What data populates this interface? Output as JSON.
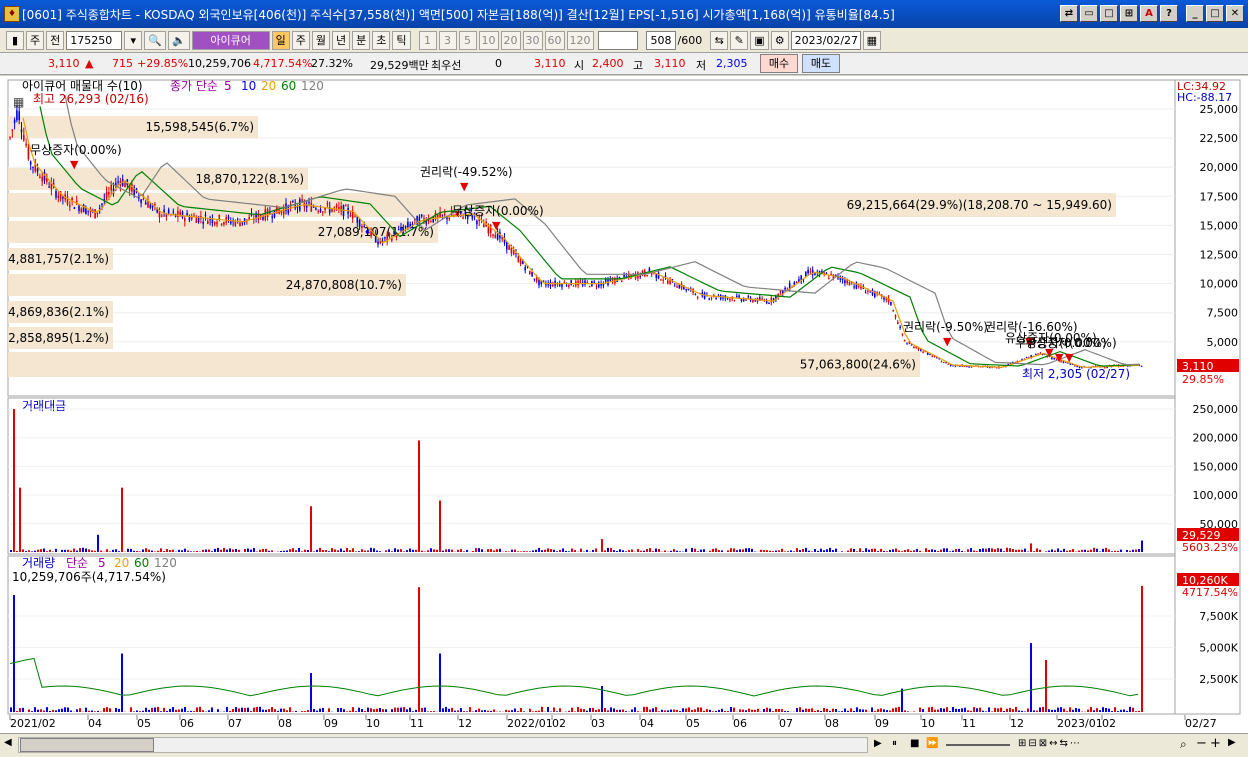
{
  "window": {
    "title": "[0601] 주식종합차트 - KOSDAQ 외국인보유[406(천)] 주식수[37,558(천)] 액면[500] 자본금[188(억)] 결산[12월] EPS[-1,516] 시가총액[1,168(억)] 유통비율[84.5]"
  },
  "toolbar": {
    "type": "주",
    "prev": "전",
    "code": "175250",
    "name": "아이큐어",
    "period_sel": "일",
    "periods": [
      "주",
      "월",
      "년",
      "분",
      "초",
      "틱"
    ],
    "minutes": [
      "1",
      "3",
      "5",
      "10",
      "20",
      "30",
      "60",
      "120"
    ],
    "count": "508",
    "total": "/600",
    "date": "2023/02/27"
  },
  "quote": {
    "price": "3,110",
    "change": "715",
    "rate": "+29.85%",
    "volume": "10,259,706",
    "vol_ratio": "4,717.54%",
    "turnover": "27.32%",
    "amount": "29,529백만",
    "pref_label": "최우선",
    "pref_val": "0",
    "ask": "3,110",
    "open_label": "시",
    "open": "2,400",
    "high_label": "고",
    "high": "3,110",
    "low_label": "저",
    "low": "2,305",
    "buy": "매수",
    "sell": "매도"
  },
  "price_panel": {
    "legend_name": "아이큐어 매물대 수(10)",
    "ma_title": "종가 단순",
    "ma": [
      "5",
      "10",
      "20",
      "60",
      "120"
    ],
    "ma_colors": [
      "#a000a0",
      "#0000ff",
      "#e8a000",
      "#008000",
      "#808080"
    ],
    "max_label": "최고 26,293 (02/16)",
    "min_label": "최저 2,305 (02/27)",
    "lc": "LC:34.92",
    "hc": "HC:-88.17",
    "price_tag": "3,110",
    "pct_tag": "29.85%",
    "axis": [
      "25,000",
      "22,500",
      "20,000",
      "17,500",
      "15,000",
      "12,500",
      "10,000",
      "7,500",
      "5,000"
    ],
    "profile": [
      {
        "label": "15,598,545(6.7%)"
      },
      {
        "label": "18,870,122(8.1%)"
      },
      {
        "label": "69,215,664(29.9%)(18,208.70 ~ 15,949.60)"
      },
      {
        "label": "27,089,107(11.7%)"
      },
      {
        "label": "4,881,757(2.1%)"
      },
      {
        "label": "24,870,808(10.7%)"
      },
      {
        "label": "4,869,836(2.1%)"
      },
      {
        "label": "2,858,895(1.2%)"
      },
      {
        "label": "57,063,800(24.6%)"
      }
    ],
    "events": [
      "권리락(-49.52%)",
      "무상증자(0.00%)",
      "무상증자(0.00%)",
      "권리락(-9.50%)",
      "권리락(-16.60%)",
      "유상증자(0.00%)",
      "무상증자(0.00%)",
      "무상증자(0.00%)"
    ]
  },
  "amount_panel": {
    "title": "거래대금",
    "axis": [
      "250,000",
      "200,000",
      "150,000",
      "100,000",
      "50,000"
    ],
    "tag1": "29,529",
    "tag2": "5603.23%"
  },
  "volume_panel": {
    "title": "거래량",
    "ma_title": "단순",
    "ma": [
      "5",
      "20",
      "60",
      "120"
    ],
    "sub": "10,259,706주(4,717.54%)",
    "axis": [
      "7,500K",
      "5,000K",
      "2,500K"
    ],
    "tag1": "10,260K",
    "tag2": "4717.54%"
  },
  "xaxis": [
    "2021/02",
    "04",
    "05",
    "06",
    "07",
    "08",
    "09",
    "10",
    "11",
    "12",
    "2022/01",
    "02",
    "03",
    "04",
    "05",
    "06",
    "07",
    "08",
    "09",
    "10",
    "11",
    "12",
    "2023/01",
    "02",
    "02/27"
  ]
}
